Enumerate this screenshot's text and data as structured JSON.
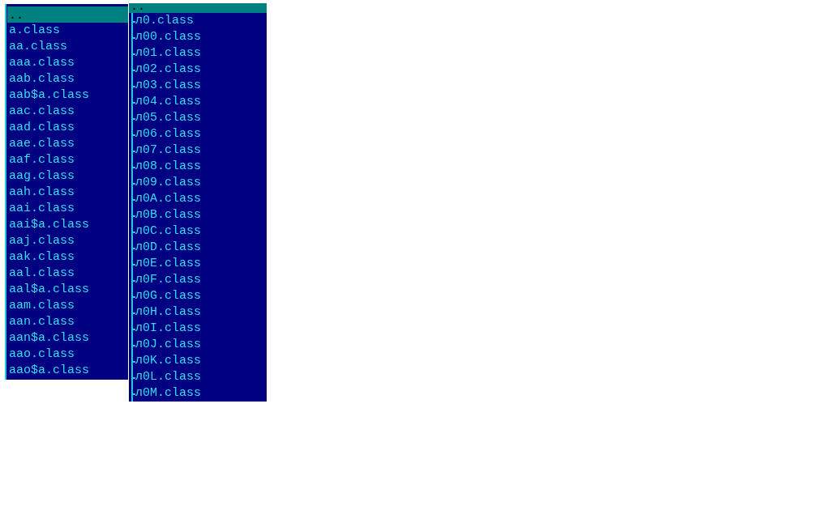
{
  "panels": [
    {
      "header": {
        "label": "..",
        "selected": true
      },
      "tree": false,
      "items": [
        {
          "label": "a.class",
          "selected": false
        },
        {
          "label": "aa.class",
          "selected": false
        },
        {
          "label": "aaa.class",
          "selected": false
        },
        {
          "label": "aab.class",
          "selected": false
        },
        {
          "label": "aab$a.class",
          "selected": false
        },
        {
          "label": "aac.class",
          "selected": false
        },
        {
          "label": "aad.class",
          "selected": false
        },
        {
          "label": "aae.class",
          "selected": false
        },
        {
          "label": "aaf.class",
          "selected": false
        },
        {
          "label": "aag.class",
          "selected": false
        },
        {
          "label": "aah.class",
          "selected": false
        },
        {
          "label": "aai.class",
          "selected": false
        },
        {
          "label": "aai$a.class",
          "selected": false
        },
        {
          "label": "aaj.class",
          "selected": false
        },
        {
          "label": "aak.class",
          "selected": false
        },
        {
          "label": "aal.class",
          "selected": false
        },
        {
          "label": "aal$a.class",
          "selected": false
        },
        {
          "label": "aam.class",
          "selected": false
        },
        {
          "label": "aan.class",
          "selected": false
        },
        {
          "label": "aan$a.class",
          "selected": false
        },
        {
          "label": "aao.class",
          "selected": false
        },
        {
          "label": "aao$a.class",
          "selected": false
        }
      ]
    },
    {
      "header": {
        "label": "..",
        "selected": true
      },
      "tree": true,
      "items": [
        {
          "label": "л0.class",
          "selected": false
        },
        {
          "label": "л00.class",
          "selected": false
        },
        {
          "label": "л01.class",
          "selected": false
        },
        {
          "label": "л02.class",
          "selected": false
        },
        {
          "label": "л03.class",
          "selected": false
        },
        {
          "label": "л04.class",
          "selected": false
        },
        {
          "label": "л05.class",
          "selected": false
        },
        {
          "label": "л06.class",
          "selected": false
        },
        {
          "label": "л07.class",
          "selected": false
        },
        {
          "label": "л08.class",
          "selected": false
        },
        {
          "label": "л09.class",
          "selected": false
        },
        {
          "label": "л0A.class",
          "selected": false
        },
        {
          "label": "л0B.class",
          "selected": false
        },
        {
          "label": "л0C.class",
          "selected": false
        },
        {
          "label": "л0D.class",
          "selected": false
        },
        {
          "label": "л0E.class",
          "selected": false
        },
        {
          "label": "л0F.class",
          "selected": false
        },
        {
          "label": "л0G.class",
          "selected": false
        },
        {
          "label": "л0H.class",
          "selected": false
        },
        {
          "label": "л0I.class",
          "selected": false
        },
        {
          "label": "л0J.class",
          "selected": false
        },
        {
          "label": "л0K.class",
          "selected": false
        },
        {
          "label": "л0L.class",
          "selected": false
        },
        {
          "label": "л0M.class",
          "selected": false
        }
      ]
    }
  ]
}
